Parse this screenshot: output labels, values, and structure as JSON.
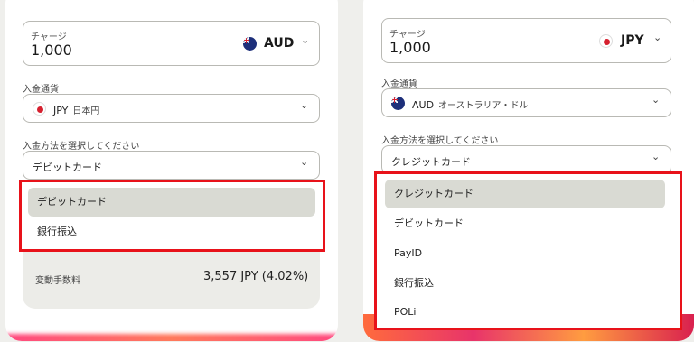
{
  "left": {
    "charge_label": "チャージ",
    "charge_amount": "1,000",
    "charge_currency": "AUD",
    "deposit_currency_label": "入金通貨",
    "deposit_currency_code": "JPY",
    "deposit_currency_name": "日本円",
    "method_label": "入金方法を選択してください",
    "method_selected": "デビットカード",
    "options": [
      "デビットカード",
      "銀行振込"
    ],
    "fee_label": "変動手数料",
    "fee_value": "3,557 JPY (4.02%)"
  },
  "right": {
    "charge_label": "チャージ",
    "charge_amount": "1,000",
    "charge_currency": "JPY",
    "deposit_currency_label": "入金通貨",
    "deposit_currency_code": "AUD",
    "deposit_currency_name": "オーストラリア・ドル",
    "method_label": "入金方法を選択してください",
    "method_selected": "クレジットカード",
    "options": [
      "クレジットカード",
      "デビットカード",
      "PayID",
      "銀行振込",
      "POLi"
    ]
  },
  "icons": {
    "chevron": "⌄"
  },
  "colors": {
    "highlight_border": "#e8121a",
    "active_option_bg": "#d9dad3"
  }
}
